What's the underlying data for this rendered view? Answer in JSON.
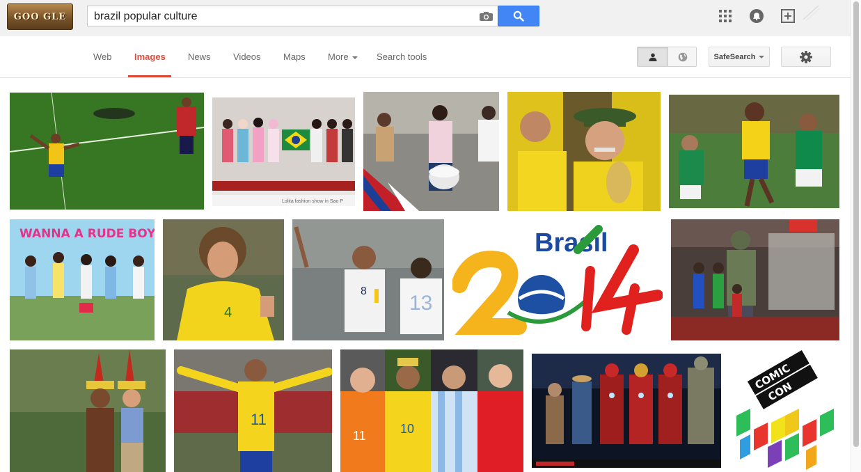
{
  "logo": {
    "text": "GOO  GLE"
  },
  "search": {
    "query": "brazil popular culture"
  },
  "tabs": [
    {
      "label": "Web",
      "active": false
    },
    {
      "label": "Images",
      "active": true
    },
    {
      "label": "News",
      "active": false
    },
    {
      "label": "Videos",
      "active": false
    },
    {
      "label": "Maps",
      "active": false
    },
    {
      "label": "More",
      "active": false
    },
    {
      "label": "Search tools",
      "active": false
    }
  ],
  "safesearch_label": "SafeSearch",
  "results": [
    {
      "row": 1,
      "subject": "soccer-celebration"
    },
    {
      "row": 1,
      "subject": "lolita-fashion-show",
      "caption": "Lolita fashion show in Sao P"
    },
    {
      "row": 1,
      "subject": "drummer-parade"
    },
    {
      "row": 1,
      "subject": "crying-fan"
    },
    {
      "row": 1,
      "subject": "brazil-vs-mexico"
    },
    {
      "row": 2,
      "subject": "kpop-poster",
      "caption": "WANNA A RUDE BOY"
    },
    {
      "row": 2,
      "subject": "david-luiz"
    },
    {
      "row": 2,
      "subject": "usa-player"
    },
    {
      "row": 2,
      "subject": "brasil-2014-logo",
      "caption": "Brasil"
    },
    {
      "row": 2,
      "subject": "comic-con-hulk"
    },
    {
      "row": 3,
      "subject": "indigenous-couple"
    },
    {
      "row": 3,
      "subject": "neymar-celebration"
    },
    {
      "row": 3,
      "subject": "four-players"
    },
    {
      "row": 3,
      "subject": "iron-man-suits"
    },
    {
      "row": 3,
      "subject": "comic-con-experience-logo",
      "caption": "COMIC CON EXPERIENCE"
    }
  ],
  "colors": {
    "accent": "#dd4b39",
    "search_blue": "#4285f4",
    "tab_text": "#666666"
  }
}
